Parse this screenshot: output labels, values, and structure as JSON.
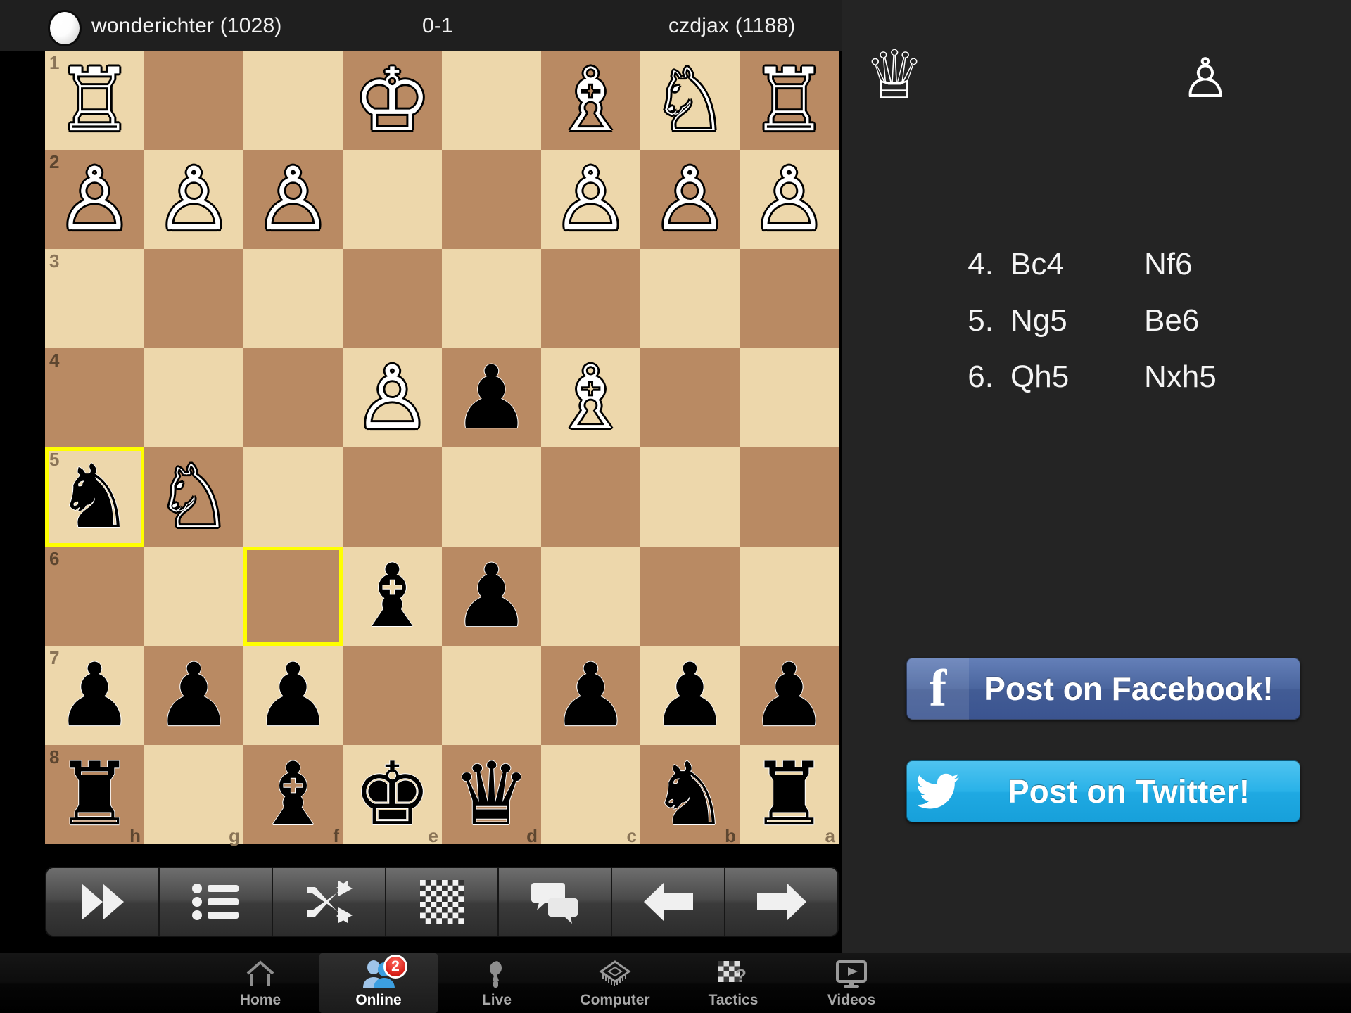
{
  "header": {
    "white_player": "wonderichter (1028)",
    "result": "0-1",
    "black_player": "czdjax (1188)",
    "avatar_name": "white-player-avatar"
  },
  "board": {
    "orientation": "black-at-bottom",
    "files": [
      "h",
      "g",
      "f",
      "e",
      "d",
      "c",
      "b",
      "a"
    ],
    "ranks": [
      "1",
      "2",
      "3",
      "4",
      "5",
      "6",
      "7",
      "8"
    ],
    "light_color": "#edd7ab",
    "dark_color": "#b98a63",
    "highlight_color": "#ffff00",
    "highlighted_squares": [
      "h5",
      "f6"
    ],
    "rows": [
      {
        "rank": "1",
        "cells": [
          {
            "sq": "h1",
            "piece": "white-rook",
            "glyph": "♖"
          },
          {
            "sq": "g1",
            "piece": null,
            "glyph": ""
          },
          {
            "sq": "f1",
            "piece": null,
            "glyph": ""
          },
          {
            "sq": "e1",
            "piece": "white-king",
            "glyph": "♔"
          },
          {
            "sq": "d1",
            "piece": null,
            "glyph": ""
          },
          {
            "sq": "c1",
            "piece": "white-bishop",
            "glyph": "♗"
          },
          {
            "sq": "b1",
            "piece": "white-knight",
            "glyph": "♘"
          },
          {
            "sq": "a1",
            "piece": "white-rook",
            "glyph": "♖"
          }
        ]
      },
      {
        "rank": "2",
        "cells": [
          {
            "sq": "h2",
            "piece": "white-pawn",
            "glyph": "♙"
          },
          {
            "sq": "g2",
            "piece": "white-pawn",
            "glyph": "♙"
          },
          {
            "sq": "f2",
            "piece": "white-pawn",
            "glyph": "♙"
          },
          {
            "sq": "e2",
            "piece": null,
            "glyph": ""
          },
          {
            "sq": "d2",
            "piece": null,
            "glyph": ""
          },
          {
            "sq": "c2",
            "piece": "white-pawn",
            "glyph": "♙"
          },
          {
            "sq": "b2",
            "piece": "white-pawn",
            "glyph": "♙"
          },
          {
            "sq": "a2",
            "piece": "white-pawn",
            "glyph": "♙"
          }
        ]
      },
      {
        "rank": "3",
        "cells": [
          {
            "sq": "h3",
            "piece": null,
            "glyph": ""
          },
          {
            "sq": "g3",
            "piece": null,
            "glyph": ""
          },
          {
            "sq": "f3",
            "piece": null,
            "glyph": ""
          },
          {
            "sq": "e3",
            "piece": null,
            "glyph": ""
          },
          {
            "sq": "d3",
            "piece": null,
            "glyph": ""
          },
          {
            "sq": "c3",
            "piece": null,
            "glyph": ""
          },
          {
            "sq": "b3",
            "piece": null,
            "glyph": ""
          },
          {
            "sq": "a3",
            "piece": null,
            "glyph": ""
          }
        ]
      },
      {
        "rank": "4",
        "cells": [
          {
            "sq": "h4",
            "piece": null,
            "glyph": ""
          },
          {
            "sq": "g4",
            "piece": null,
            "glyph": ""
          },
          {
            "sq": "f4",
            "piece": null,
            "glyph": ""
          },
          {
            "sq": "e4",
            "piece": "white-pawn",
            "glyph": "♙"
          },
          {
            "sq": "d4",
            "piece": "black-pawn",
            "glyph": "♟"
          },
          {
            "sq": "c4",
            "piece": "white-bishop",
            "glyph": "♗"
          },
          {
            "sq": "b4",
            "piece": null,
            "glyph": ""
          },
          {
            "sq": "a4",
            "piece": null,
            "glyph": ""
          }
        ]
      },
      {
        "rank": "5",
        "cells": [
          {
            "sq": "h5",
            "piece": "black-knight",
            "glyph": "♞"
          },
          {
            "sq": "g5",
            "piece": "white-knight",
            "glyph": "♘"
          },
          {
            "sq": "f5",
            "piece": null,
            "glyph": ""
          },
          {
            "sq": "e5",
            "piece": null,
            "glyph": ""
          },
          {
            "sq": "d5",
            "piece": null,
            "glyph": ""
          },
          {
            "sq": "c5",
            "piece": null,
            "glyph": ""
          },
          {
            "sq": "b5",
            "piece": null,
            "glyph": ""
          },
          {
            "sq": "a5",
            "piece": null,
            "glyph": ""
          }
        ]
      },
      {
        "rank": "6",
        "cells": [
          {
            "sq": "h6",
            "piece": null,
            "glyph": ""
          },
          {
            "sq": "g6",
            "piece": null,
            "glyph": ""
          },
          {
            "sq": "f6",
            "piece": null,
            "glyph": ""
          },
          {
            "sq": "e6",
            "piece": "black-bishop",
            "glyph": "♝"
          },
          {
            "sq": "d6",
            "piece": "black-pawn",
            "glyph": "♟"
          },
          {
            "sq": "c6",
            "piece": null,
            "glyph": ""
          },
          {
            "sq": "b6",
            "piece": null,
            "glyph": ""
          },
          {
            "sq": "a6",
            "piece": null,
            "glyph": ""
          }
        ]
      },
      {
        "rank": "7",
        "cells": [
          {
            "sq": "h7",
            "piece": "black-pawn",
            "glyph": "♟"
          },
          {
            "sq": "g7",
            "piece": "black-pawn",
            "glyph": "♟"
          },
          {
            "sq": "f7",
            "piece": "black-pawn",
            "glyph": "♟"
          },
          {
            "sq": "e7",
            "piece": null,
            "glyph": ""
          },
          {
            "sq": "d7",
            "piece": null,
            "glyph": ""
          },
          {
            "sq": "c7",
            "piece": "black-pawn",
            "glyph": "♟"
          },
          {
            "sq": "b7",
            "piece": "black-pawn",
            "glyph": "♟"
          },
          {
            "sq": "a7",
            "piece": "black-pawn",
            "glyph": "♟"
          }
        ]
      },
      {
        "rank": "8",
        "cells": [
          {
            "sq": "h8",
            "piece": "black-rook",
            "glyph": "♜"
          },
          {
            "sq": "g8",
            "piece": null,
            "glyph": ""
          },
          {
            "sq": "f8",
            "piece": "black-bishop",
            "glyph": "♝"
          },
          {
            "sq": "e8",
            "piece": "black-king",
            "glyph": "♚"
          },
          {
            "sq": "d8",
            "piece": "black-queen",
            "glyph": "♛"
          },
          {
            "sq": "c8",
            "piece": null,
            "glyph": ""
          },
          {
            "sq": "b8",
            "piece": "black-knight",
            "glyph": "♞"
          },
          {
            "sq": "a8",
            "piece": "black-rook",
            "glyph": "♜"
          }
        ]
      }
    ]
  },
  "toolbar": {
    "buttons": [
      {
        "name": "fast-forward-icon",
        "label": "Fast forward"
      },
      {
        "name": "move-list-icon",
        "label": "Move list"
      },
      {
        "name": "shuffle-icon",
        "label": "Shuffle"
      },
      {
        "name": "board-settings-icon",
        "label": "Board"
      },
      {
        "name": "chat-icon",
        "label": "Chat"
      },
      {
        "name": "previous-move-icon",
        "label": "Back"
      },
      {
        "name": "next-move-icon",
        "label": "Forward"
      }
    ]
  },
  "captured": {
    "white_queen_glyph": "♕",
    "white_pawn_glyph": "♙"
  },
  "moves": [
    {
      "number": "4.",
      "white": "Bc4",
      "black": "Nf6"
    },
    {
      "number": "5.",
      "white": "Ng5",
      "black": "Be6"
    },
    {
      "number": "6.",
      "white": "Qh5",
      "black": "Nxh5"
    }
  ],
  "social": {
    "facebook_label": "Post on Facebook!",
    "facebook_logo": "f",
    "facebook_color": "#4a659e",
    "twitter_label": "Post on Twitter!",
    "twitter_color": "#29b2e8"
  },
  "tabbar": {
    "tabs": [
      {
        "label": "Home",
        "icon": "home-icon",
        "active": false,
        "badge": null
      },
      {
        "label": "Online",
        "icon": "people-icon",
        "active": true,
        "badge": "2"
      },
      {
        "label": "Live",
        "icon": "live-icon",
        "active": false,
        "badge": null
      },
      {
        "label": "Computer",
        "icon": "chip-icon",
        "active": false,
        "badge": null
      },
      {
        "label": "Tactics",
        "icon": "tactics-icon",
        "active": false,
        "badge": null
      },
      {
        "label": "Videos",
        "icon": "video-icon",
        "active": false,
        "badge": null
      }
    ]
  }
}
